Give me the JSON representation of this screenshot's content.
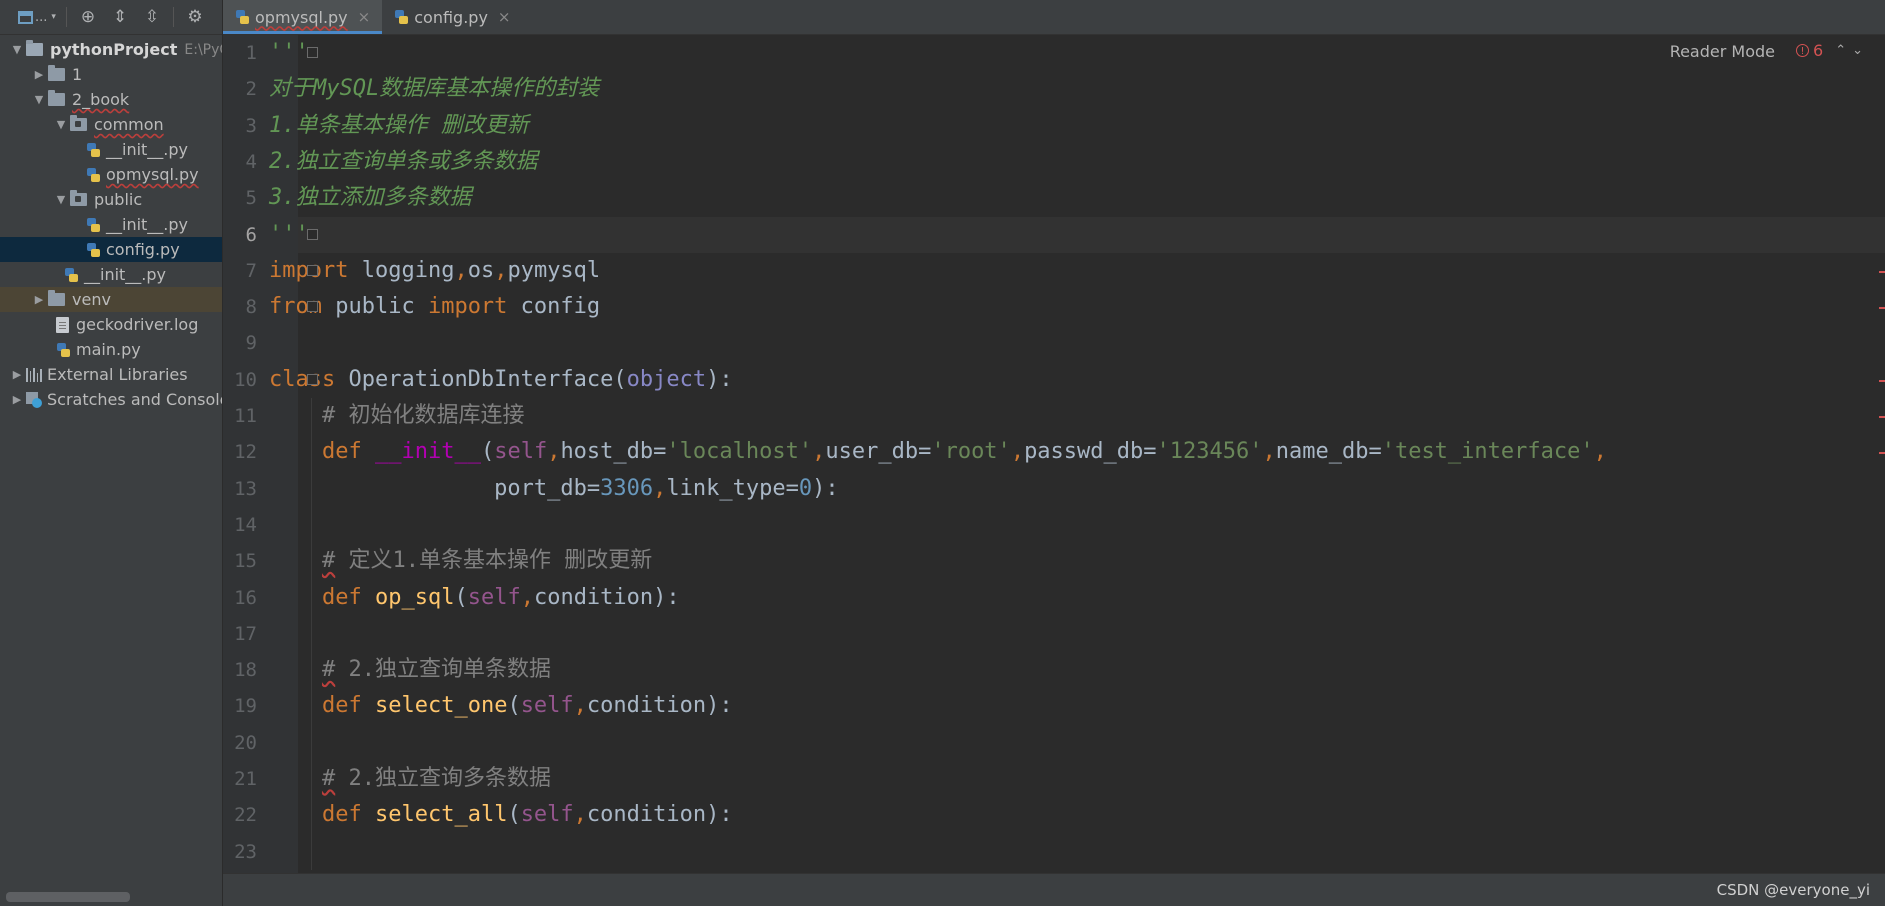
{
  "sidebar": {
    "toolbar": {
      "project_label": "..."
    },
    "tree": [
      {
        "label": "pythonProject",
        "path": "E:\\PyCh",
        "kind": "root",
        "expanded": true,
        "depth": 0
      },
      {
        "label": "1",
        "kind": "folder",
        "expanded": false,
        "depth": 1
      },
      {
        "label": "2_book",
        "kind": "folder",
        "expanded": true,
        "depth": 1
      },
      {
        "label": "common",
        "kind": "module",
        "expanded": true,
        "depth": 2
      },
      {
        "label": "__init__.py",
        "kind": "py",
        "depth": 3
      },
      {
        "label": "opmysql.py",
        "kind": "py",
        "depth": 3
      },
      {
        "label": "public",
        "kind": "module",
        "expanded": true,
        "depth": 2
      },
      {
        "label": "__init__.py",
        "kind": "py",
        "depth": 3
      },
      {
        "label": "config.py",
        "kind": "py",
        "depth": 3,
        "selected": true
      },
      {
        "label": "__init__.py",
        "kind": "py",
        "depth": 2
      },
      {
        "label": "venv",
        "kind": "folder",
        "expanded": false,
        "depth": 1,
        "excluded": true
      },
      {
        "label": "geckodriver.log",
        "kind": "log",
        "depth": 1
      },
      {
        "label": "main.py",
        "kind": "py",
        "depth": 1
      },
      {
        "label": "External Libraries",
        "kind": "libs",
        "expanded": false,
        "depth": 0
      },
      {
        "label": "Scratches and Consoles",
        "kind": "scratch",
        "expanded": false,
        "depth": 0
      }
    ]
  },
  "tabs": [
    {
      "label": "opmysql.py",
      "active": true
    },
    {
      "label": "config.py",
      "active": false
    }
  ],
  "editor": {
    "reader_mode": "Reader Mode",
    "problem_count": "6",
    "line_numbers": [
      "1",
      "2",
      "3",
      "4",
      "5",
      "6",
      "7",
      "8",
      "9",
      "10",
      "11",
      "12",
      "13",
      "14",
      "15",
      "16",
      "17",
      "18",
      "19",
      "20",
      "21",
      "22",
      "23"
    ],
    "current_line": 6
  },
  "status": {
    "watermark": "CSDN @everyone_yi"
  }
}
